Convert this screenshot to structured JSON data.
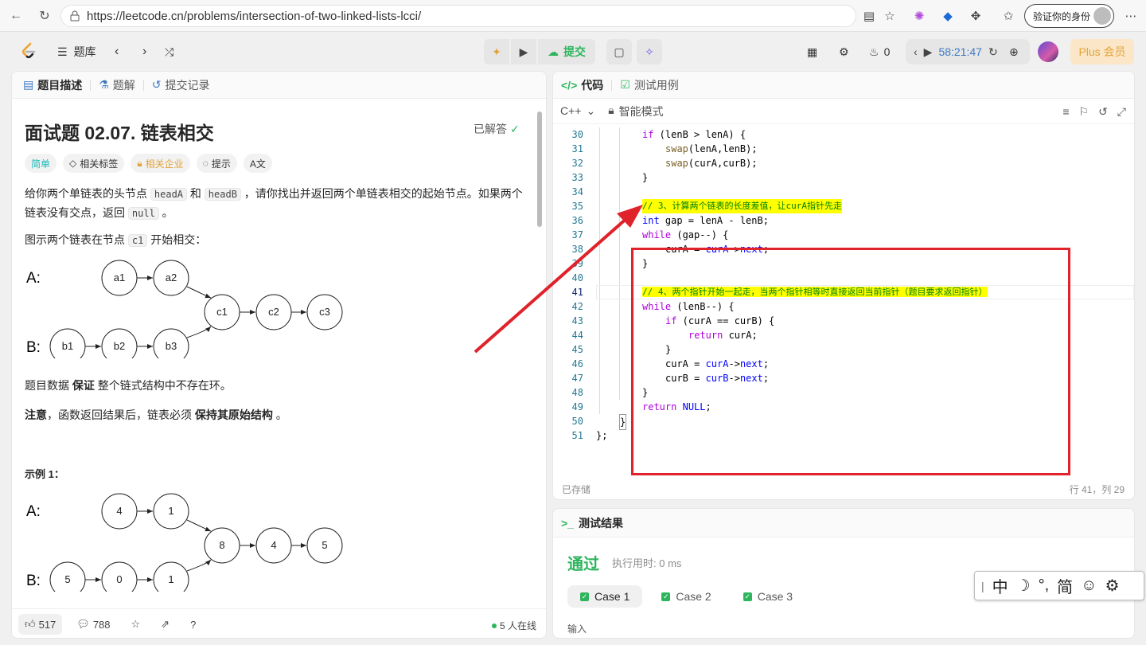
{
  "browser": {
    "url": "https://leetcode.cn/problems/intersection-of-two-linked-lists-lcci/",
    "verify_label": "验证你的身份"
  },
  "header": {
    "problem_bank": "题库",
    "submit": "提交",
    "notification_count": "0",
    "timer": "58:21:47",
    "plus": "Plus 会员"
  },
  "left": {
    "tabs": [
      "题目描述",
      "题解",
      "提交记录"
    ],
    "title": "面试题 02.07. 链表相交",
    "solved": "已解答",
    "tags": [
      "简单",
      "相关标签",
      "相关企业",
      "提示"
    ],
    "desc1_a": "给你两个单链表的头节点 ",
    "desc1_code1": "headA",
    "desc1_b": " 和 ",
    "desc1_code2": "headB",
    "desc1_c": " ，请你找出并返回两个单链表相交的起始节点。如果两个链表没有交点，返回 ",
    "desc1_code3": "null",
    "desc1_d": " 。",
    "desc2_a": "图示两个链表在节点 ",
    "desc2_code": "c1",
    "desc2_b": " 开始相交：",
    "diagram1": {
      "labelA": "A:",
      "labelB": "B:",
      "nodesA": [
        "a1",
        "a2"
      ],
      "nodesB": [
        "b1",
        "b2",
        "b3"
      ],
      "nodesC": [
        "c1",
        "c2",
        "c3"
      ]
    },
    "guarantee_a": "题目数据 ",
    "guarantee_b": "保证",
    "guarantee_c": " 整个链式结构中不存在环。",
    "note_a": "注意",
    "note_b": "，函数返回结果后，链表必须 ",
    "note_c": "保持其原始结构",
    "note_d": " 。",
    "example_title": "示例 1：",
    "diagram2": {
      "labelA": "A:",
      "labelB": "B:",
      "nodesA": [
        "4",
        "1"
      ],
      "nodesB": [
        "5",
        "0",
        "1"
      ],
      "nodesC": [
        "8",
        "4",
        "5"
      ]
    },
    "footer": {
      "likes": "517",
      "comments": "788",
      "online": "5 人在线"
    }
  },
  "code": {
    "tabs": [
      "代码",
      "测试用例"
    ],
    "language": "C++",
    "mode": "智能模式",
    "saved": "已存储",
    "position": "行 41，列 29",
    "lines": [
      {
        "n": "30",
        "t": "if (lenB > lenA) {"
      },
      {
        "n": "31",
        "t": "swap(lenA,lenB);"
      },
      {
        "n": "32",
        "t": "swap(curA,curB);"
      },
      {
        "n": "33",
        "t": "}"
      },
      {
        "n": "34",
        "t": ""
      },
      {
        "n": "35",
        "t": "// 3、计算两个链表的长度差值，让curA指针先走"
      },
      {
        "n": "36",
        "t": "int gap = lenA - lenB;"
      },
      {
        "n": "37",
        "t": "while (gap--) {"
      },
      {
        "n": "38",
        "t": "curA = curA->next;"
      },
      {
        "n": "39",
        "t": "}"
      },
      {
        "n": "40",
        "t": ""
      },
      {
        "n": "41",
        "t": "// 4、两个指针开始一起走，当两个指针相等时直接返回当前指针（题目要求返回指针）"
      },
      {
        "n": "42",
        "t": "while (lenB--) {"
      },
      {
        "n": "43",
        "t": "if (curA == curB) {"
      },
      {
        "n": "44",
        "t": "return curA;"
      },
      {
        "n": "45",
        "t": "}"
      },
      {
        "n": "46",
        "t": "curA = curA->next;"
      },
      {
        "n": "47",
        "t": "curB = curB->next;"
      },
      {
        "n": "48",
        "t": "}"
      },
      {
        "n": "49",
        "t": "return NULL;"
      },
      {
        "n": "50",
        "t": "}"
      },
      {
        "n": "51",
        "t": "};"
      }
    ]
  },
  "result": {
    "title": "测试结果",
    "status": "通过",
    "runtime": "执行用时: 0 ms",
    "cases": [
      "Case 1",
      "Case 2",
      "Case 3"
    ],
    "input_label": "输入"
  },
  "ime": {
    "chinese": "中",
    "simplified": "简"
  },
  "colors": {
    "accent_green": "#2db55d",
    "annotation_red": "#e0222a",
    "highlight_yellow": "#ffff00"
  }
}
